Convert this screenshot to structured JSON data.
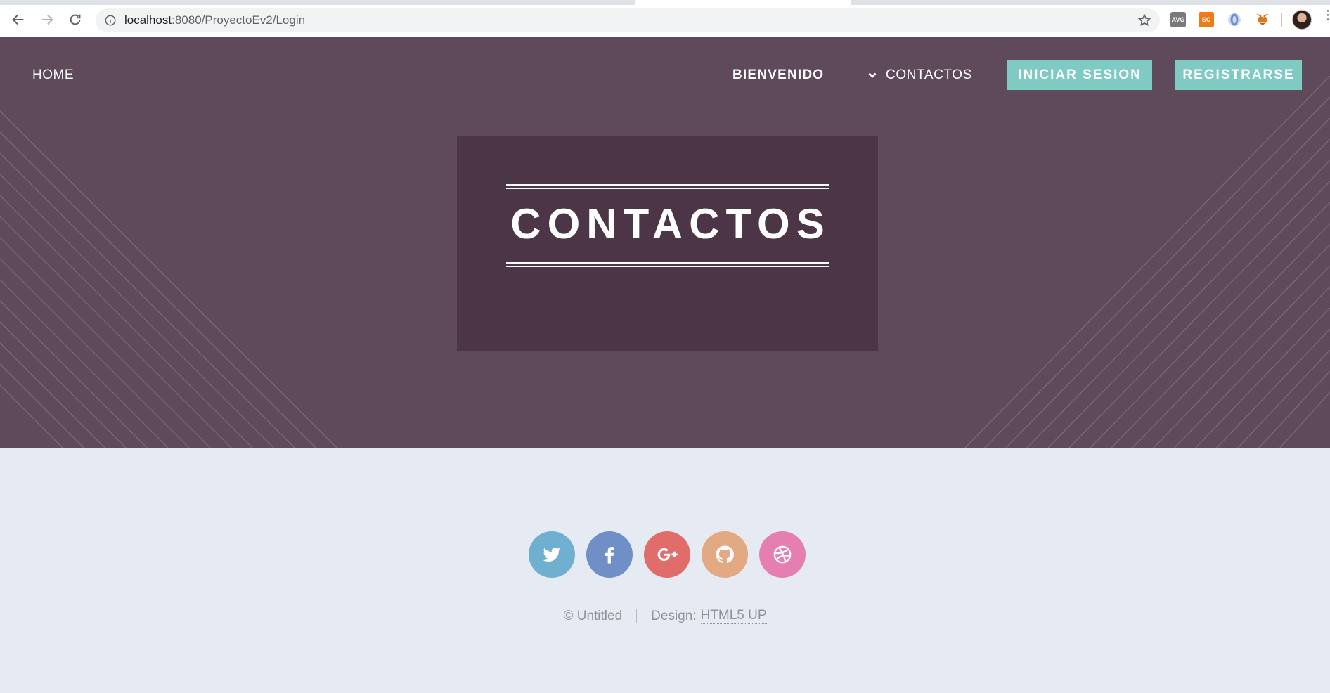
{
  "browser": {
    "url_host": "localhost",
    "url_path": ":8080/ProyectoEv2/Login",
    "extensions": [
      {
        "name": "avg-icon",
        "label": "AVG",
        "color": "#7a7a7a"
      },
      {
        "name": "sc-icon",
        "label": "SC",
        "color": "#f07b16"
      },
      {
        "name": "opera-icon",
        "label": "",
        "color": "#6e8fcf"
      },
      {
        "name": "metamask-icon",
        "label": "",
        "color": "#e2761b"
      }
    ]
  },
  "nav": {
    "home": "HOME",
    "welcome": "BIENVENIDO",
    "contacts": "CONTACTOS",
    "login": "INICIAR SESION",
    "register": "REGISTRARSE"
  },
  "banner": {
    "title": "CONTACTOS"
  },
  "footer": {
    "copyright": "© Untitled",
    "design_label": "Design:",
    "design_link": "HTML5 UP",
    "social": [
      "twitter",
      "facebook",
      "google-plus",
      "github",
      "dribbble"
    ]
  },
  "colors": {
    "banner_bg": "#5e4a5a",
    "title_box_bg": "#4b3546",
    "button_accent": "#7fcbc4",
    "footer_bg": "#e6ebf3"
  }
}
